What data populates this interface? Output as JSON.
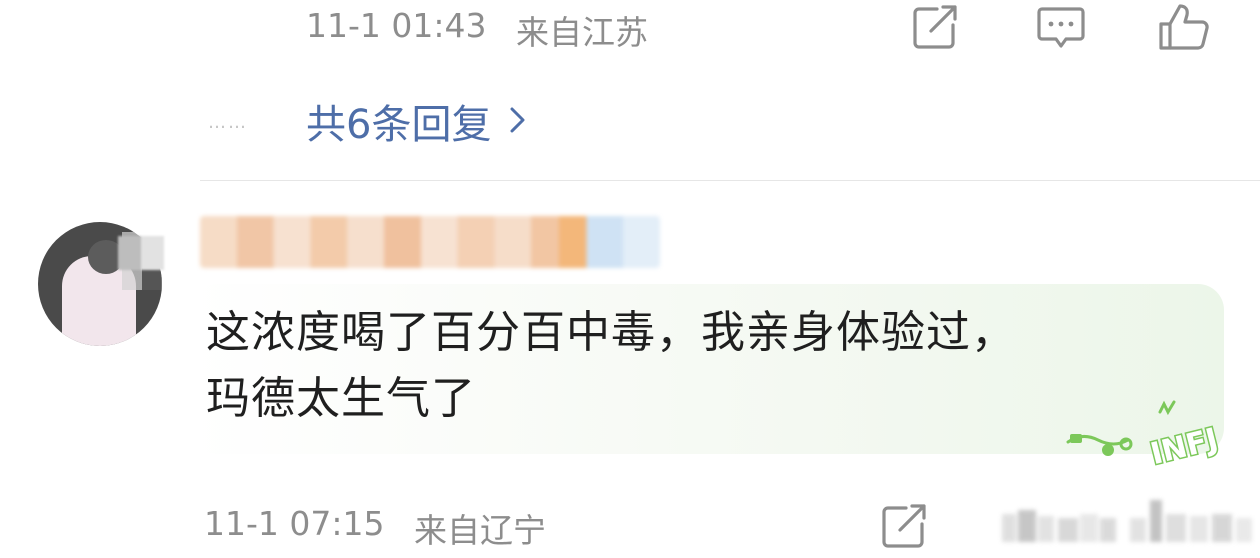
{
  "previous_comment": {
    "timestamp": "11-1 01:43",
    "location": "来自江苏",
    "actions": [
      {
        "name": "share-icon"
      },
      {
        "name": "comment-icon"
      },
      {
        "name": "like-icon"
      }
    ]
  },
  "replies_link": {
    "dots": "……",
    "label": "共6条回复",
    "chevron": "chevron-right-icon"
  },
  "comment": {
    "avatar": "user-avatar",
    "text_line1": "这浓度喝了百分百中毒，我亲身体验过，",
    "text_line2": "玛德太生气了",
    "decoration": "INFJ",
    "timestamp": "11-1 07:15",
    "location": "来自辽宁",
    "actions": [
      {
        "name": "share-icon"
      },
      {
        "name": "comment-icon"
      },
      {
        "name": "like-icon"
      }
    ]
  },
  "colors": {
    "meta": "#8d8d8d",
    "link": "#4e6ea8",
    "bubble_green": "#ecf6e9",
    "decoration_green": "#7cc85a"
  }
}
